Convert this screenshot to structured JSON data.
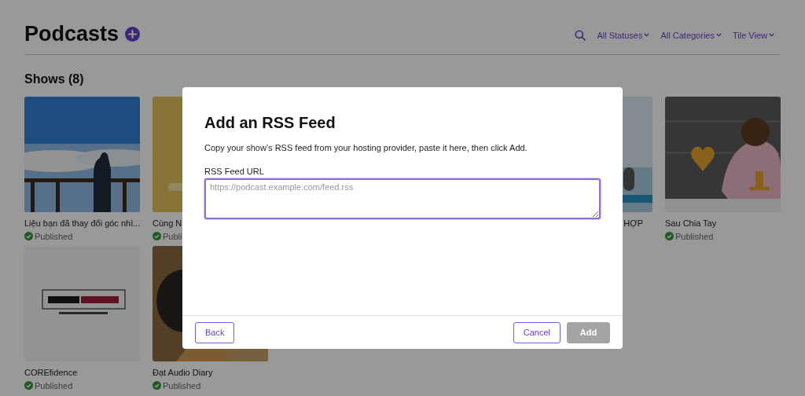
{
  "header": {
    "title": "Podcasts",
    "filters": [
      {
        "label": "All Statuses"
      },
      {
        "label": "All Categories"
      },
      {
        "label": "Tile View"
      }
    ]
  },
  "section": {
    "title": "Shows (8)"
  },
  "shows": [
    {
      "title": "Liệu bạn đã thay đổi góc nhì...",
      "status": "Published"
    },
    {
      "title": "Cùng N",
      "status": "Publi"
    },
    {
      "title": "HỢP"
    },
    {
      "title": "Sau Chia Tay",
      "status": "Published"
    },
    {
      "title": "COREfidence",
      "status": "Published"
    },
    {
      "title": "Đạt Audio Diary",
      "status": "Published"
    }
  ],
  "dialog": {
    "title": "Add an RSS Feed",
    "description": "Copy your show’s RSS feed from your hosting provider, paste it here, then click Add.",
    "field": {
      "label": "RSS Feed URL",
      "placeholder": "https://podcast.example.com/feed.rss"
    },
    "buttons": [
      {
        "label": "Back",
        "kind": "secondary",
        "disabled": false
      },
      {
        "label": "Cancel",
        "kind": "secondary",
        "disabled": false
      },
      {
        "label": "Add",
        "kind": "primary",
        "disabled": true
      }
    ]
  }
}
